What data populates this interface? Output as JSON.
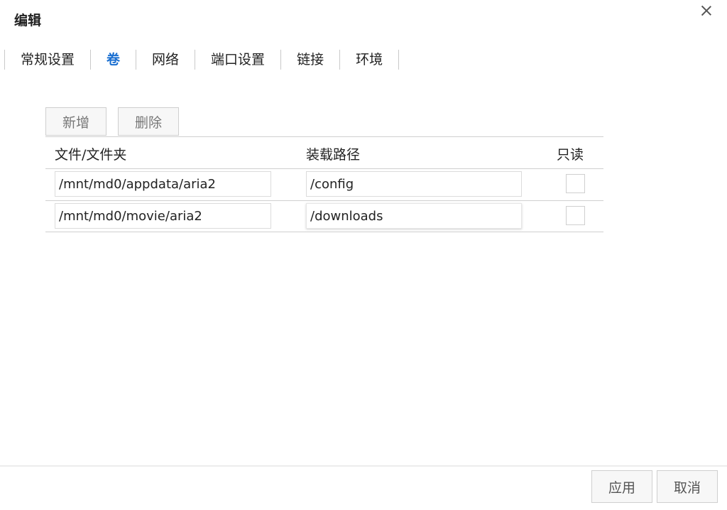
{
  "dialog": {
    "title": "编辑",
    "close_icon": "close-icon"
  },
  "tabs": [
    {
      "label": "常规设置",
      "active": false
    },
    {
      "label": "卷",
      "active": true
    },
    {
      "label": "网络",
      "active": false
    },
    {
      "label": "端口设置",
      "active": false
    },
    {
      "label": "链接",
      "active": false
    },
    {
      "label": "环境",
      "active": false
    }
  ],
  "toolbar": {
    "add_label": "新增",
    "delete_label": "删除"
  },
  "table": {
    "columns": [
      "文件/文件夹",
      "装载路径",
      "只读"
    ],
    "rows": [
      {
        "path": "/mnt/md0/appdata/aria2",
        "mount": "/config",
        "readonly": false
      },
      {
        "path": "/mnt/md0/movie/aria2",
        "mount": "/downloads",
        "readonly": false
      }
    ]
  },
  "footer": {
    "apply_label": "应用",
    "cancel_label": "取消"
  },
  "colors": {
    "active_tab": "#1a6fd1"
  }
}
